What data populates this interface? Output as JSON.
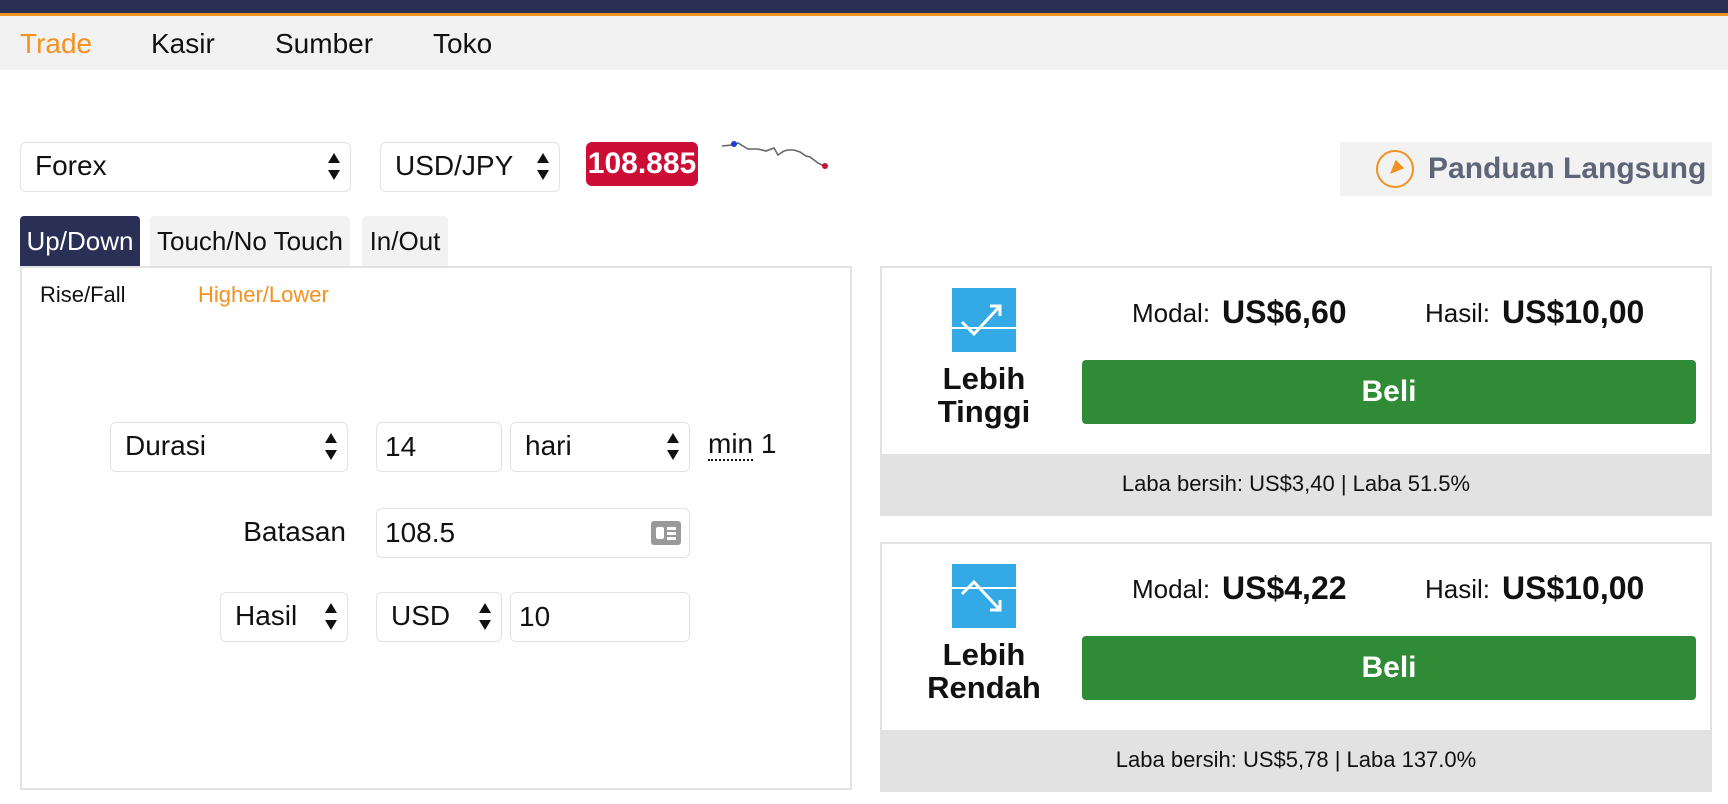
{
  "nav": {
    "items": [
      {
        "label": "Trade",
        "active": true
      },
      {
        "label": "Kasir"
      },
      {
        "label": "Sumber"
      },
      {
        "label": "Toko"
      }
    ]
  },
  "market": {
    "category": "Forex",
    "symbol": "USD/JPY",
    "price": "108.885",
    "price_color": "#cc0e37"
  },
  "guide": {
    "label": "Panduan Langsung",
    "icon": "navigate-icon"
  },
  "tabs": [
    {
      "label": "Up/Down",
      "active": true
    },
    {
      "label": "Touch/No Touch"
    },
    {
      "label": "In/Out"
    }
  ],
  "subtabs": [
    {
      "label": "Rise/Fall"
    },
    {
      "label": "Higher/Lower",
      "active": true
    }
  ],
  "form": {
    "duration_type": "Durasi",
    "duration_value": "14",
    "duration_unit": "hari",
    "min_prefix": "min",
    "min_value": "1",
    "barrier_label": "Batasan",
    "barrier_value": "108.5",
    "payout_type": "Hasil",
    "currency": "USD",
    "amount": "10"
  },
  "contracts": [
    {
      "title_line1": "Lebih",
      "title_line2": "Tinggi",
      "stake_label": "Modal:",
      "stake_value": "US$6,60",
      "payout_label": "Hasil:",
      "payout_value": "US$10,00",
      "buy_label": "Beli",
      "profit": "Laba bersih: US$3,40 | Laba 51.5%",
      "icon": "trend-up-icon"
    },
    {
      "title_line1": "Lebih",
      "title_line2": "Rendah",
      "stake_label": "Modal:",
      "stake_value": "US$4,22",
      "payout_label": "Hasil:",
      "payout_value": "US$10,00",
      "buy_label": "Beli",
      "profit": "Laba bersih: US$5,78 | Laba 137.0%",
      "icon": "trend-down-icon"
    }
  ],
  "colors": {
    "accent": "#f39121",
    "navy": "#2a2f55",
    "buy": "#2f8b36",
    "icon_blue": "#33aae6"
  }
}
